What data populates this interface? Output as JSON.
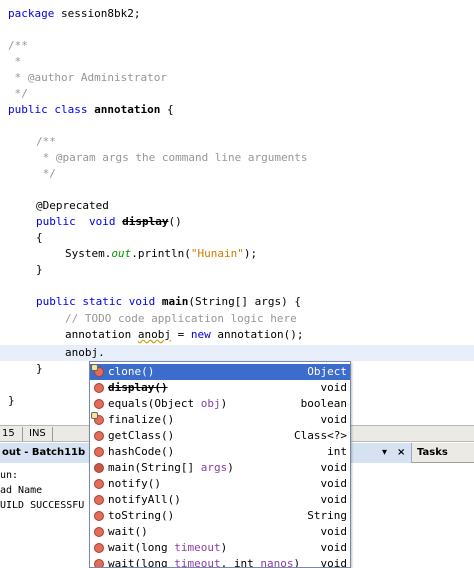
{
  "editor": {
    "package_kw": "package",
    "package_name": " session8bk2;",
    "jdoc_open": "/**",
    "jdoc_star": " *",
    "author_line": " * @author Administrator",
    "jdoc_close": " */",
    "class_public": "public",
    "class_kw": " class",
    "class_name": " annotation",
    "class_brace": " {",
    "m1_jdoc_open": "/**",
    "m1_param": " * @param args the command line arguments",
    "m1_jdoc_close": " */",
    "deprecated": "@Deprecated",
    "display_public": "public",
    "display_void": "  void",
    "display_name": "display",
    "display_parens": "()",
    "open_brace": "{",
    "println_pre": "System.",
    "println_out": "out",
    "println_mid": ".println(",
    "println_str": "\"Hunain\"",
    "println_end": ");",
    "close_brace": "}",
    "main_public": "public",
    "main_static": " static",
    "main_void": " void",
    "main_name": "main",
    "main_sig": "(String[] args) {",
    "todo": "// TODO code application logic here",
    "new_pre": "annotation ",
    "new_var": "anobj",
    "new_eq": " = ",
    "new_kw": "new",
    "new_post": " annotation();",
    "typing": "anobj.",
    "main_close": "}",
    "class_close": "}"
  },
  "status": {
    "line_col": "15",
    "mode": "INS"
  },
  "output": {
    "tab_label": "out - Batch11b (ru",
    "pin": "▾",
    "close": "×",
    "tasks_label": "Tasks",
    "lines": [
      "un:",
      "ad Name",
      "UILD SUCCESSFU"
    ]
  },
  "completion": {
    "items": [
      {
        "name": "clone()",
        "ret": "Object",
        "icon": "protected-method-icon"
      },
      {
        "name": "display()",
        "ret": "void",
        "icon": "method-icon",
        "deprecated": true
      },
      {
        "name": "equals(Object ",
        "param": "obj",
        "name_end": ")",
        "ret": "boolean",
        "icon": "method-icon"
      },
      {
        "name": "finalize()",
        "ret": "void",
        "icon": "protected-method-icon"
      },
      {
        "name": "getClass()",
        "ret": "Class<?>",
        "icon": "method-icon"
      },
      {
        "name": "hashCode()",
        "ret": "int",
        "icon": "method-icon"
      },
      {
        "name": "main(String[] ",
        "param": "args",
        "name_end": ")",
        "ret": "void",
        "icon": "static-method-icon"
      },
      {
        "name": "notify()",
        "ret": "void",
        "icon": "method-icon"
      },
      {
        "name": "notifyAll()",
        "ret": "void",
        "icon": "method-icon"
      },
      {
        "name": "toString()",
        "ret": "String",
        "icon": "method-icon"
      },
      {
        "name": "wait()",
        "ret": "void",
        "icon": "method-icon"
      },
      {
        "name": "wait(long ",
        "param": "timeout",
        "name_end": ")",
        "ret": "void",
        "icon": "method-icon"
      },
      {
        "name": "wait(long ",
        "param": "timeout",
        "name_mid": ", int ",
        "param2": "nanos",
        "name_end": ")",
        "ret": "void",
        "icon": "method-icon"
      }
    ]
  },
  "colors": {
    "keyword": "#0000e6",
    "comment": "#969696",
    "string": "#ce7b00",
    "field": "#009900",
    "selection": "#3c6ccc",
    "current_line": "#e9effa"
  }
}
